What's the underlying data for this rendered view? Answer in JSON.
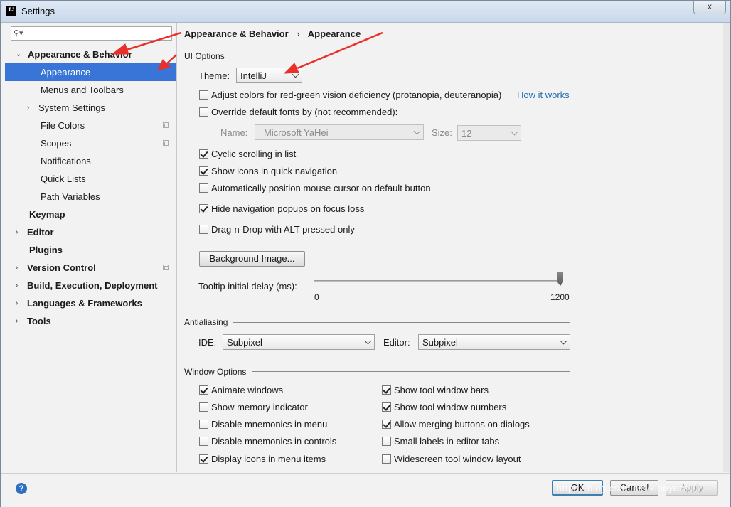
{
  "window": {
    "title": "Settings",
    "app_icon_text": "IJ",
    "close_label": "x"
  },
  "sidebar": {
    "search_placeholder": "",
    "items": [
      {
        "label": "Appearance & Behavior",
        "expanded": true
      },
      {
        "label": "Appearance",
        "selected": true
      },
      {
        "label": "Menus and Toolbars"
      },
      {
        "label": "System Settings"
      },
      {
        "label": "File Colors"
      },
      {
        "label": "Scopes"
      },
      {
        "label": "Notifications"
      },
      {
        "label": "Quick Lists"
      },
      {
        "label": "Path Variables"
      },
      {
        "label": "Keymap"
      },
      {
        "label": "Editor"
      },
      {
        "label": "Plugins"
      },
      {
        "label": "Version Control"
      },
      {
        "label": "Build, Execution, Deployment"
      },
      {
        "label": "Languages & Frameworks"
      },
      {
        "label": "Tools"
      }
    ]
  },
  "breadcrumb": {
    "parent": "Appearance & Behavior",
    "separator": "›",
    "current": "Appearance"
  },
  "ui_options": {
    "section_title": "UI Options",
    "theme_label": "Theme:",
    "theme_value": "IntelliJ",
    "adjust_colors": {
      "label": "Adjust colors for red-green vision deficiency (protanopia, deuteranopia)",
      "checked": false
    },
    "how_it_works": "How it works",
    "override_fonts": {
      "label": "Override default fonts by (not recommended):",
      "checked": false
    },
    "font_name_label": "Name:",
    "font_name_value": "Microsoft YaHei",
    "font_size_label": "Size:",
    "font_size_value": "12",
    "cyclic_scrolling": {
      "label": "Cyclic scrolling in list",
      "checked": true
    },
    "show_icons_nav": {
      "label": "Show icons in quick navigation",
      "checked": true
    },
    "auto_position_cursor": {
      "label": "Automatically position mouse cursor on default button",
      "checked": false
    },
    "hide_nav_popups": {
      "label": "Hide navigation popups on focus loss",
      "checked": true
    },
    "drag_n_drop_alt": {
      "label": "Drag-n-Drop with ALT pressed only",
      "checked": false
    },
    "background_image_button": "Background Image...",
    "tooltip_delay_label": "Tooltip initial delay (ms):",
    "tooltip_delay_min": "0",
    "tooltip_delay_max": "1200",
    "tooltip_delay_value": 1200
  },
  "antialiasing": {
    "section_title": "Antialiasing",
    "ide_label": "IDE:",
    "ide_value": "Subpixel",
    "editor_label": "Editor:",
    "editor_value": "Subpixel"
  },
  "window_options": {
    "section_title": "Window Options",
    "left": [
      {
        "label": "Animate windows",
        "checked": true
      },
      {
        "label": "Show memory indicator",
        "checked": false
      },
      {
        "label": "Disable mnemonics in menu",
        "checked": false
      },
      {
        "label": "Disable mnemonics in controls",
        "checked": false
      },
      {
        "label": "Display icons in menu items",
        "checked": true
      }
    ],
    "right": [
      {
        "label": "Show tool window bars",
        "checked": true
      },
      {
        "label": "Show tool window numbers",
        "checked": true
      },
      {
        "label": "Allow merging buttons on dialogs",
        "checked": true
      },
      {
        "label": "Small labels in editor tabs",
        "checked": false
      },
      {
        "label": "Widescreen tool window layout",
        "checked": false
      }
    ]
  },
  "footer": {
    "help_label": "?",
    "ok_label": "OK",
    "cancel_label": "Cancel",
    "apply_label": "Apply",
    "watermark": "https://blog.csdn.net/xiaoyezhu"
  },
  "colors": {
    "selection": "#3875d7",
    "link": "#2470b3",
    "annotation_arrow": "#e8312a"
  }
}
